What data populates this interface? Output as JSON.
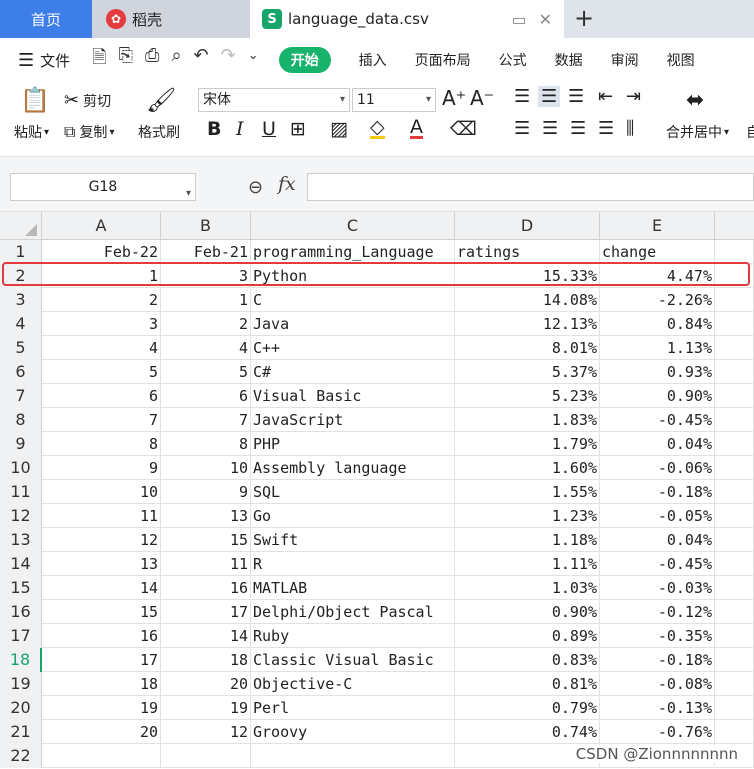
{
  "tabs": {
    "home": "首页",
    "daoke": "稻壳",
    "file": "language_data.csv"
  },
  "menu": {
    "file": "文件",
    "start": "开始",
    "insert": "插入",
    "layout": "页面布局",
    "formula": "公式",
    "data": "数据",
    "review": "审阅",
    "view": "视图"
  },
  "ribbon": {
    "paste": "粘贴",
    "cut": "剪切",
    "copy": "复制",
    "format_painter": "格式刷",
    "font_name": "宋体",
    "font_size": "11",
    "merge_center": "合并居中",
    "overflow": "自"
  },
  "formula_bar": {
    "name_box": "G18",
    "fx": "fx"
  },
  "columns": [
    "A",
    "B",
    "C",
    "D",
    "E"
  ],
  "rows": [
    {
      "n": "1",
      "A": "Feb-22",
      "B": "Feb-21",
      "C": "programming_Language",
      "D": "ratings",
      "E": "change"
    },
    {
      "n": "2",
      "A": "1",
      "B": "3",
      "C": "Python",
      "D": "15.33%",
      "E": "4.47%"
    },
    {
      "n": "3",
      "A": "2",
      "B": "1",
      "C": "C",
      "D": "14.08%",
      "E": "-2.26%"
    },
    {
      "n": "4",
      "A": "3",
      "B": "2",
      "C": "Java",
      "D": "12.13%",
      "E": "0.84%"
    },
    {
      "n": "5",
      "A": "4",
      "B": "4",
      "C": "C++",
      "D": "8.01%",
      "E": "1.13%"
    },
    {
      "n": "6",
      "A": "5",
      "B": "5",
      "C": "C#",
      "D": "5.37%",
      "E": "0.93%"
    },
    {
      "n": "7",
      "A": "6",
      "B": "6",
      "C": "Visual Basic",
      "D": "5.23%",
      "E": "0.90%"
    },
    {
      "n": "8",
      "A": "7",
      "B": "7",
      "C": "JavaScript",
      "D": "1.83%",
      "E": "-0.45%"
    },
    {
      "n": "9",
      "A": "8",
      "B": "8",
      "C": "PHP",
      "D": "1.79%",
      "E": "0.04%"
    },
    {
      "n": "10",
      "A": "9",
      "B": "10",
      "C": "Assembly language",
      "D": "1.60%",
      "E": "-0.06%"
    },
    {
      "n": "11",
      "A": "10",
      "B": "9",
      "C": "SQL",
      "D": "1.55%",
      "E": "-0.18%"
    },
    {
      "n": "12",
      "A": "11",
      "B": "13",
      "C": "Go",
      "D": "1.23%",
      "E": "-0.05%"
    },
    {
      "n": "13",
      "A": "12",
      "B": "15",
      "C": "Swift",
      "D": "1.18%",
      "E": "0.04%"
    },
    {
      "n": "14",
      "A": "13",
      "B": "11",
      "C": "R",
      "D": "1.11%",
      "E": "-0.45%"
    },
    {
      "n": "15",
      "A": "14",
      "B": "16",
      "C": "MATLAB",
      "D": "1.03%",
      "E": "-0.03%"
    },
    {
      "n": "16",
      "A": "15",
      "B": "17",
      "C": "Delphi/Object Pascal",
      "D": "0.90%",
      "E": "-0.12%"
    },
    {
      "n": "17",
      "A": "16",
      "B": "14",
      "C": "Ruby",
      "D": "0.89%",
      "E": "-0.35%"
    },
    {
      "n": "18",
      "A": "17",
      "B": "18",
      "C": "Classic Visual Basic",
      "D": "0.83%",
      "E": "-0.18%"
    },
    {
      "n": "19",
      "A": "18",
      "B": "20",
      "C": "Objective-C",
      "D": "0.81%",
      "E": "-0.08%"
    },
    {
      "n": "20",
      "A": "19",
      "B": "19",
      "C": "Perl",
      "D": "0.79%",
      "E": "-0.13%"
    },
    {
      "n": "21",
      "A": "20",
      "B": "12",
      "C": "Groovy",
      "D": "0.74%",
      "E": "-0.76%"
    },
    {
      "n": "22",
      "A": "",
      "B": "",
      "C": "",
      "D": "",
      "E": ""
    }
  ],
  "selected_row": "18",
  "watermark": "CSDN @Zionnnnnnnn",
  "colors": {
    "accent": "#17b26b",
    "home_tab": "#3d7ee8",
    "highlight": "#e23b3b"
  }
}
